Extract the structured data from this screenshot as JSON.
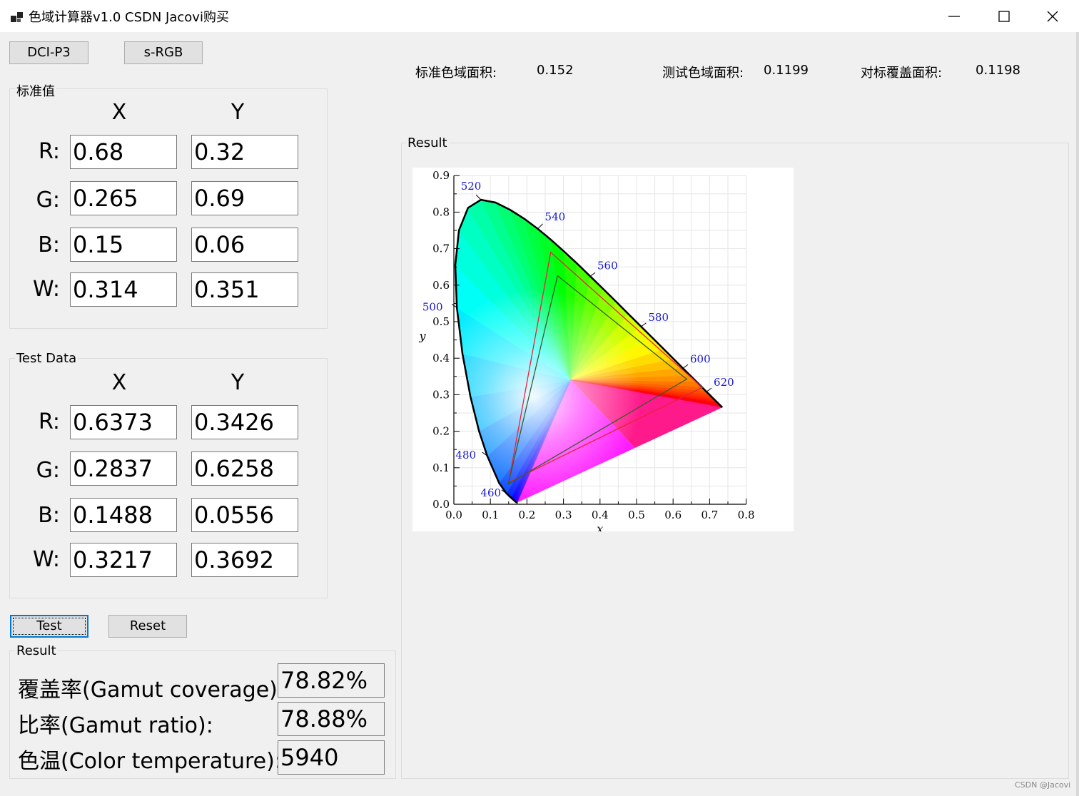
{
  "window": {
    "title": "色域计算器v1.0  CSDN Jacovi购买"
  },
  "toolbar": {
    "dci_p3_label": "DCI-P3",
    "srgb_label": "s-RGB"
  },
  "stats": {
    "standard_area_label": "标准色域面积:",
    "standard_area_value": "0.152",
    "test_area_label": "测试色域面积:",
    "test_area_value": "0.1199",
    "overlap_area_label": "对标覆盖面积:",
    "overlap_area_value": "0.1198"
  },
  "standard": {
    "title": "标准值",
    "col_x": "X",
    "col_y": "Y",
    "rows": [
      {
        "label": "R:",
        "x": "0.68",
        "y": "0.32"
      },
      {
        "label": "G:",
        "x": "0.265",
        "y": "0.69"
      },
      {
        "label": "B:",
        "x": "0.15",
        "y": "0.06"
      },
      {
        "label": "W:",
        "x": "0.314",
        "y": "0.351"
      }
    ]
  },
  "test": {
    "title": "Test Data",
    "col_x": "X",
    "col_y": "Y",
    "rows": [
      {
        "label": "R:",
        "x": "0.6373",
        "y": "0.3426"
      },
      {
        "label": "G:",
        "x": "0.2837",
        "y": "0.6258"
      },
      {
        "label": "B:",
        "x": "0.1488",
        "y": "0.0556"
      },
      {
        "label": "W:",
        "x": "0.3217",
        "y": "0.3692"
      }
    ]
  },
  "actions": {
    "test_label": "Test",
    "reset_label": "Reset"
  },
  "result": {
    "title": "Result",
    "coverage_label": "覆盖率(Gamut coverage):",
    "coverage_value": "78.82%",
    "ratio_label": "比率(Gamut ratio):",
    "ratio_value": "78.88%",
    "temp_label": "色温(Color temperature):",
    "temp_value": "5940"
  },
  "chart_panel": {
    "title": "Result"
  },
  "chart_data": {
    "type": "scatter",
    "xlabel": "x",
    "ylabel": "y",
    "xlim": [
      0,
      0.8
    ],
    "ylim": [
      0,
      0.9
    ],
    "x_ticks": [
      "0.0",
      "0.1",
      "0.2",
      "0.3",
      "0.4",
      "0.5",
      "0.6",
      "0.7",
      "0.8"
    ],
    "y_ticks": [
      "0.0",
      "0.1",
      "0.2",
      "0.3",
      "0.4",
      "0.5",
      "0.6",
      "0.7",
      "0.8",
      "0.9"
    ],
    "spectral_locus": [
      [
        0.1741,
        0.005
      ],
      [
        0.1738,
        0.0049
      ],
      [
        0.1733,
        0.0048
      ],
      [
        0.1726,
        0.0048
      ],
      [
        0.1714,
        0.0051
      ],
      [
        0.1689,
        0.0069
      ],
      [
        0.1644,
        0.0109
      ],
      [
        0.1566,
        0.0177
      ],
      [
        0.144,
        0.0297
      ],
      [
        0.1241,
        0.0578
      ],
      [
        0.0913,
        0.1327
      ],
      [
        0.0687,
        0.2007
      ],
      [
        0.0454,
        0.295
      ],
      [
        0.0235,
        0.4127
      ],
      [
        0.0082,
        0.5384
      ],
      [
        0.0039,
        0.6548
      ],
      [
        0.0139,
        0.7502
      ],
      [
        0.0389,
        0.812
      ],
      [
        0.0743,
        0.8338
      ],
      [
        0.1142,
        0.8262
      ],
      [
        0.1547,
        0.8059
      ],
      [
        0.1929,
        0.7816
      ],
      [
        0.2296,
        0.7543
      ],
      [
        0.2658,
        0.7243
      ],
      [
        0.3016,
        0.6923
      ],
      [
        0.3373,
        0.6589
      ],
      [
        0.3731,
        0.6245
      ],
      [
        0.4087,
        0.5896
      ],
      [
        0.4441,
        0.5547
      ],
      [
        0.4788,
        0.5202
      ],
      [
        0.5125,
        0.4866
      ],
      [
        0.5448,
        0.4544
      ],
      [
        0.5752,
        0.4242
      ],
      [
        0.6029,
        0.3965
      ],
      [
        0.627,
        0.3725
      ],
      [
        0.6482,
        0.3514
      ],
      [
        0.6658,
        0.334
      ],
      [
        0.6801,
        0.3197
      ],
      [
        0.6915,
        0.3083
      ],
      [
        0.7006,
        0.2993
      ],
      [
        0.7079,
        0.292
      ],
      [
        0.714,
        0.2859
      ],
      [
        0.719,
        0.2809
      ],
      [
        0.723,
        0.277
      ],
      [
        0.726,
        0.274
      ],
      [
        0.7283,
        0.2717
      ],
      [
        0.73,
        0.27
      ],
      [
        0.7347,
        0.2653
      ]
    ],
    "wavelength_labels": [
      {
        "nm": "460",
        "x": 0.144,
        "y": 0.0297
      },
      {
        "nm": "480",
        "x": 0.0913,
        "y": 0.1327
      },
      {
        "nm": "500",
        "x": 0.0082,
        "y": 0.5384
      },
      {
        "nm": "520",
        "x": 0.0743,
        "y": 0.8338
      },
      {
        "nm": "540",
        "x": 0.2296,
        "y": 0.7543
      },
      {
        "nm": "560",
        "x": 0.3731,
        "y": 0.6245
      },
      {
        "nm": "580",
        "x": 0.5125,
        "y": 0.4866
      },
      {
        "nm": "600",
        "x": 0.627,
        "y": 0.3725
      },
      {
        "nm": "620",
        "x": 0.6915,
        "y": 0.3083
      }
    ],
    "series": [
      {
        "name": "标准值",
        "color": "#e8213a",
        "points": [
          [
            0.68,
            0.32
          ],
          [
            0.265,
            0.69
          ],
          [
            0.15,
            0.06
          ]
        ],
        "white": [
          0.314,
          0.351
        ]
      },
      {
        "name": "Test Data",
        "color": "#3a5a2a",
        "points": [
          [
            0.6373,
            0.3426
          ],
          [
            0.2837,
            0.6258
          ],
          [
            0.1488,
            0.0556
          ]
        ],
        "white": [
          0.3217,
          0.3692
        ]
      }
    ],
    "grid": true
  },
  "footer": {
    "watermark": "CSDN @Jacovi"
  }
}
